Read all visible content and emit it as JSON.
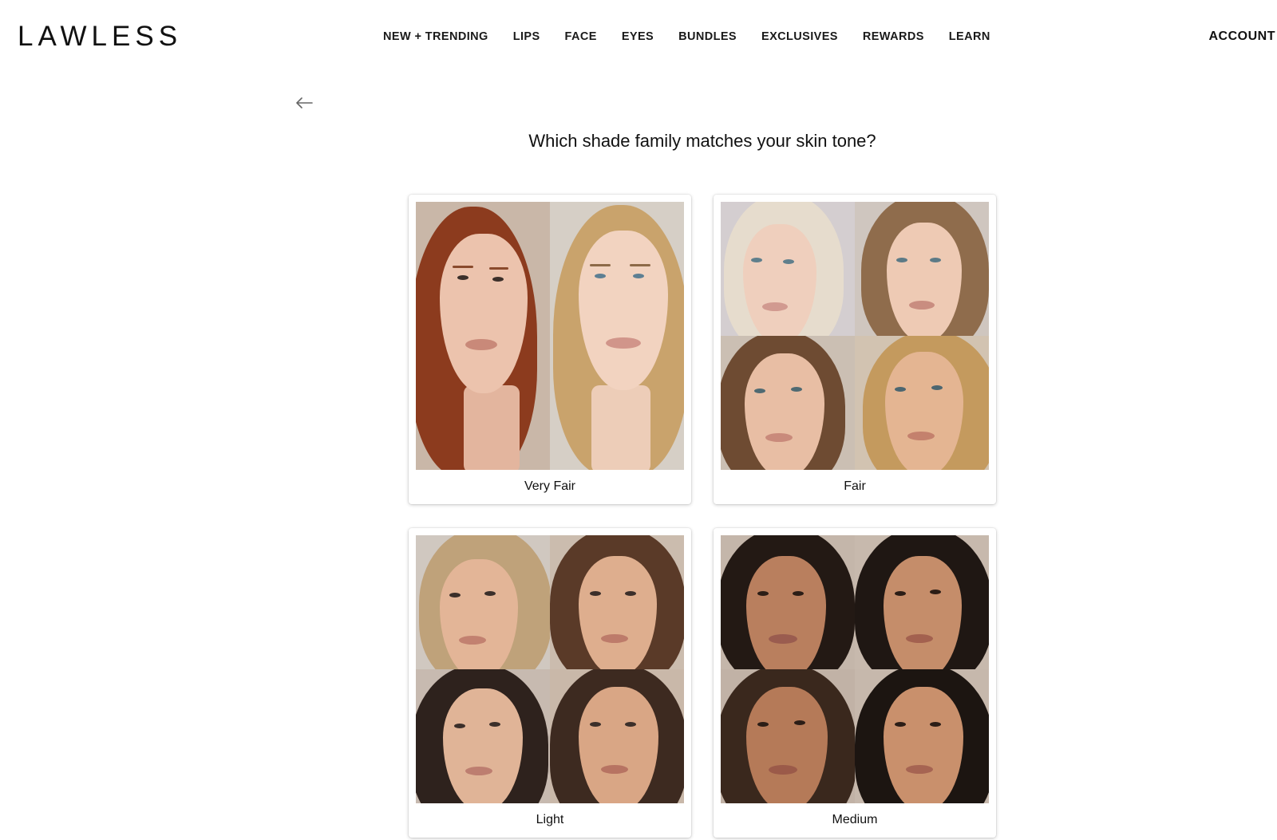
{
  "header": {
    "logo": "LAWLESS",
    "nav": [
      "NEW + TRENDING",
      "LIPS",
      "FACE",
      "EYES",
      "BUNDLES",
      "EXCLUSIVES",
      "REWARDS",
      "LEARN"
    ],
    "account": "ACCOUNT"
  },
  "quiz": {
    "back_icon": "arrow-left-icon",
    "question": "Which shade family matches your skin tone?",
    "options": [
      {
        "label": "Very Fair"
      },
      {
        "label": "Fair"
      },
      {
        "label": "Light"
      },
      {
        "label": "Medium"
      }
    ]
  },
  "colors": {
    "text": "#111111",
    "card_shadow": "#cfcfcf",
    "photo_background": "#e7e4e1"
  }
}
